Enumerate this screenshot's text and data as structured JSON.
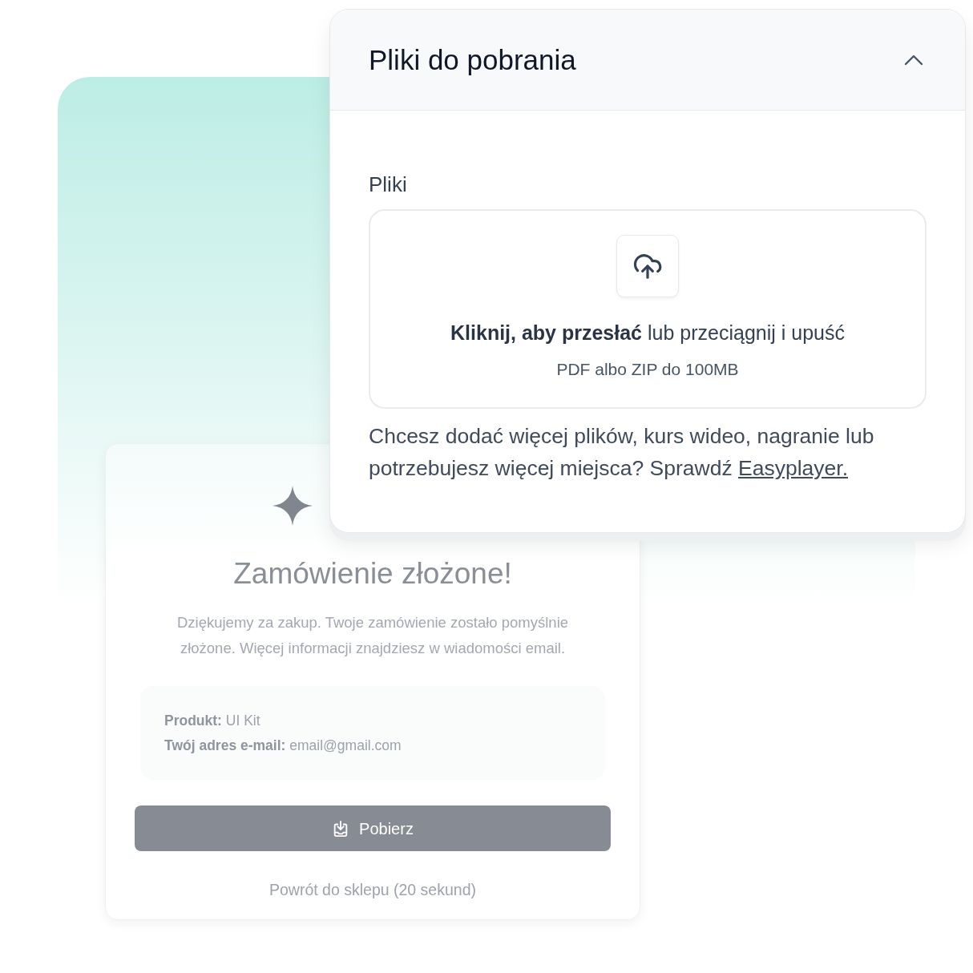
{
  "order_card": {
    "title": "Zamówienie złożone!",
    "message": "Dziękujemy za zakup. Twoje zamówienie zostało pomyślnie złożone. Więcej informacji znajdziesz w wiadomości email.",
    "details": [
      "**Produkt:** UI Kit",
      "**Twój adres e-mail:** email@gmail.com"
    ],
    "download_button": "Pobierz",
    "back_link": "Powrót do sklepu (20 sekund)"
  },
  "files_panel": {
    "title": "Pliki do pobrania",
    "expanded": true,
    "field_label": "Pliki",
    "dropzone": {
      "prompt": "**Kliknij, aby przesłać** lub przeciągnij i upuść",
      "hint": "PDF albo ZIP do 100MB"
    },
    "note": {
      "text": "Chcesz dodać więcej plików, kurs wideo, nagranie lub potrzebujesz więcej miejsca? Sprawdź",
      "link": "Easyplayer."
    }
  }
}
